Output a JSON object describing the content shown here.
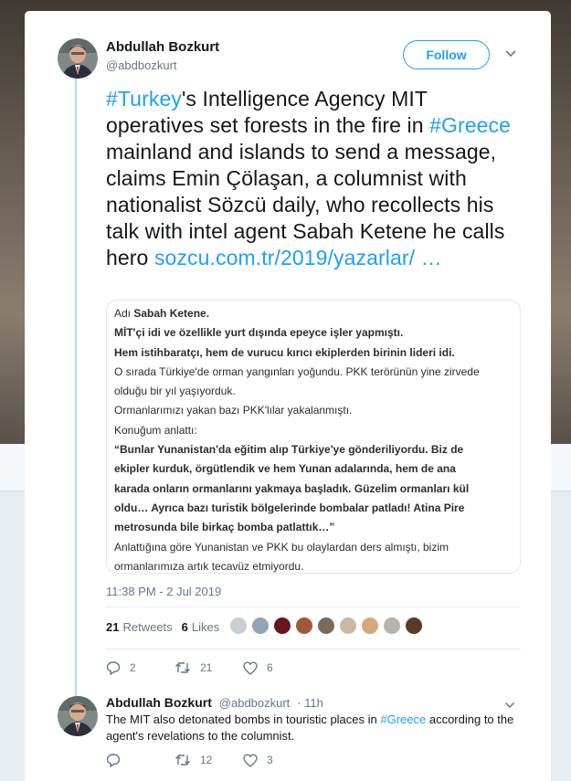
{
  "tweet": {
    "author_name": "Abdullah Bozkurt",
    "author_handle": "@abdbozkurt",
    "follow_label": "Follow",
    "text": {
      "hashtag1": "#Turkey",
      "part1": "'s Intelligence Agency MIT operatives set forests in the fire in ",
      "hashtag2": "#Greece",
      "part2": " mainland and islands to send a message, claims Emin Çölaşan, a columnist with nationalist Sözcü daily, who recollects his talk with intel agent Sabah Ketene he calls hero ",
      "link": "sozcu.com.tr/2019/yazarlar/",
      "ellipsis": " …"
    },
    "timestamp": "11:38 PM - 2 Jul 2019",
    "retweets_count": "21",
    "retweets_label": "Retweets",
    "likes_count": "6",
    "likes_label": "Likes",
    "actions": {
      "reply_count": "2",
      "retweet_count": "21",
      "like_count": "6"
    }
  },
  "media": {
    "lines": [
      "Adı Sabah Ketene.",
      "MİT'çi idi ve özellikle yurt dışında epeyce işler yapmıştı.",
      "Hem istihbaratçı, hem de vurucu kırıcı ekiplerden birinin lideri idi.",
      "O sırada Türkiye'de orman yangınları yoğundu. PKK terörünün yine zirvede",
      "olduğu bir yıl yaşıyorduk.",
      "Ormanlarımızı yakan bazı PKK'lılar yakalanmıştı.",
      "Konuğum anlattı:",
      "“Bunlar Yunanistan'da eğitim alıp Türkiye'ye gönderiliyordu. Biz de",
      "ekipler kurduk, örgütlendik ve hem Yunan adalarında, hem de ana",
      "karada onların ormanlarını yakmaya başladık. Güzelim ormanları kül",
      "oldu… Ayrıca bazı turistik bölgelerinde bombalar patladı! Atina Pire",
      "metrosunda bile birkaç bomba patlattık…”",
      "Anlattığına göre Yunanistan ve PKK bu olaylardan ders almıştı, bizim",
      "ormanlarımıza artık tecavüz etmiyordu."
    ]
  },
  "reply": {
    "author_name": "Abdullah Bozkurt",
    "author_handle": "@abdbozkurt",
    "time": "· 11h",
    "text_part1": "The MIT also detonated bombs in touristic places in ",
    "hashtag": "#Greece",
    "text_part2": " according to the agent's revelations to the columnist.",
    "retweet_count": "12",
    "like_count": "3"
  },
  "colors": {
    "accent": "#1da1f2",
    "thread_line": "#a9dcf8",
    "muted": "#657786"
  }
}
